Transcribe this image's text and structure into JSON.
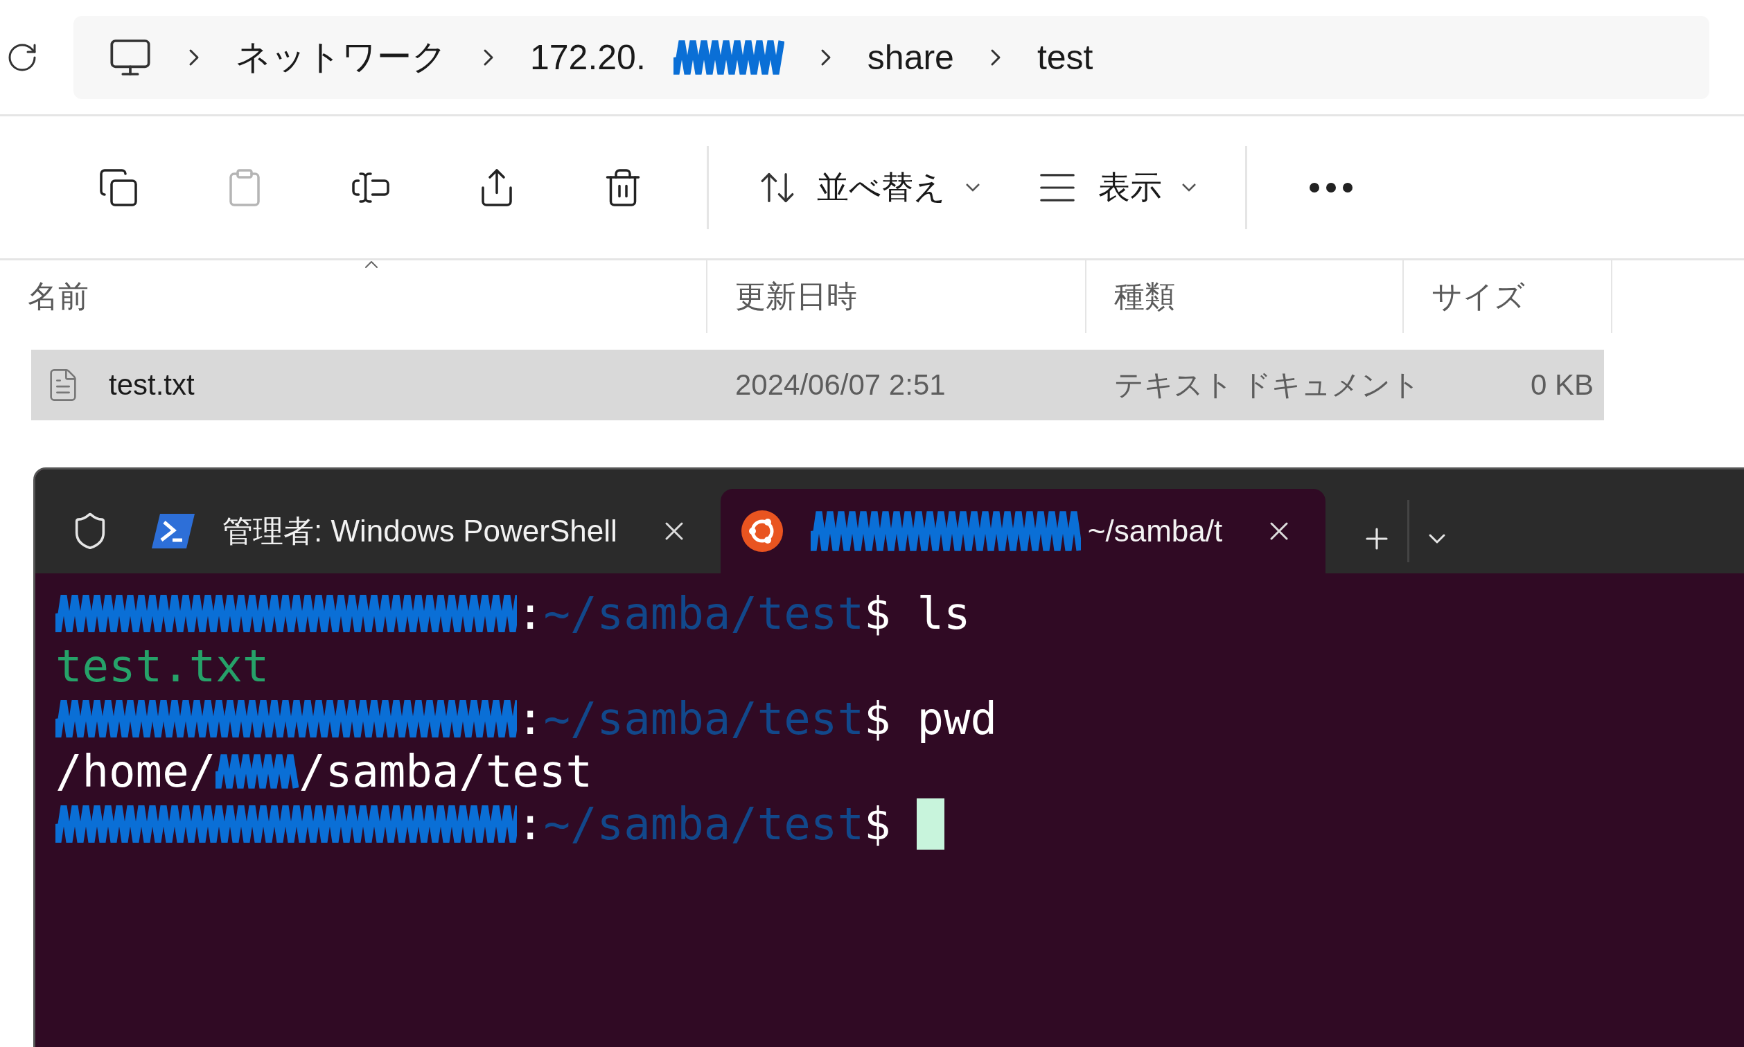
{
  "breadcrumb": {
    "items": [
      {
        "kind": "computer"
      },
      {
        "kind": "text",
        "label": "ネットワーク"
      },
      {
        "kind": "redacted",
        "label": "172.20."
      },
      {
        "kind": "text",
        "label": "share"
      },
      {
        "kind": "text",
        "label": "test"
      }
    ]
  },
  "toolbar": {
    "buttons": [
      {
        "kind": "copy",
        "disabled": false
      },
      {
        "kind": "paste",
        "disabled": true
      },
      {
        "kind": "rename",
        "disabled": false
      },
      {
        "kind": "share",
        "disabled": false
      },
      {
        "kind": "delete",
        "disabled": false
      },
      {
        "kind": "separator"
      },
      {
        "kind": "sort",
        "label": "並べ替え"
      },
      {
        "kind": "view",
        "label": "表示"
      },
      {
        "kind": "separator"
      },
      {
        "kind": "more"
      }
    ]
  },
  "table": {
    "columns": [
      {
        "label": "名前",
        "sorted": true
      },
      {
        "label": "更新日時",
        "sorted": false
      },
      {
        "label": "種類",
        "sorted": false
      },
      {
        "label": "サイズ",
        "sorted": false
      }
    ],
    "rows": [
      {
        "name": "test.txt",
        "modified": "2024/06/07 2:51",
        "type": "テキスト ドキュメント",
        "size": "0 KB",
        "selected": true
      }
    ]
  },
  "terminal": {
    "tabs": [
      {
        "kind": "powershell",
        "title": "管理者: Windows PowerShell",
        "redacted": false,
        "selected": false
      },
      {
        "kind": "ubuntu",
        "title": "~/samba/t",
        "redacted": true,
        "selected": true
      }
    ],
    "lines": [
      {
        "kind": "prompt",
        "colon": ":",
        "path": "~/samba/test",
        "sign": "$",
        "command": "ls",
        "cursor": false
      },
      {
        "kind": "file",
        "text": "test.txt"
      },
      {
        "kind": "prompt",
        "colon": ":",
        "path": "~/samba/test",
        "sign": "$",
        "command": "pwd",
        "cursor": false
      },
      {
        "kind": "output",
        "parts": [
          "/home/",
          "/samba/test"
        ]
      },
      {
        "kind": "prompt",
        "colon": ":",
        "path": "~/samba/test",
        "sign": "$",
        "cursor": true
      }
    ]
  }
}
